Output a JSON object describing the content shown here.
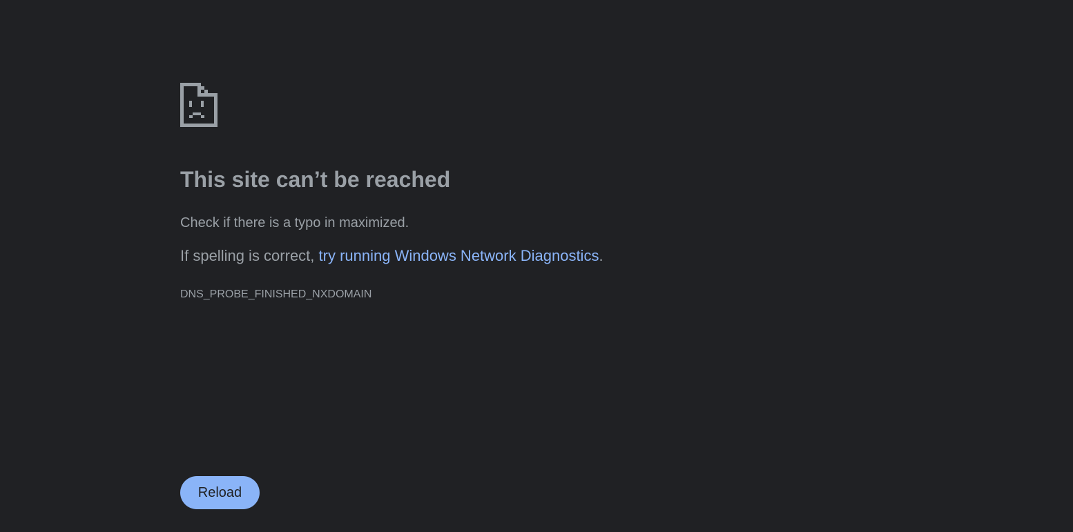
{
  "error_page": {
    "icon": "sad-document-icon",
    "title": "This site can’t be reached",
    "check_text": "Check if there is a typo in maximized.",
    "spelling_prefix": "If spelling is correct, ",
    "diagnostics_link": "try running Windows Network Diagnostics",
    "spelling_suffix": ".",
    "error_code": "DNS_PROBE_FINISHED_NXDOMAIN",
    "reload_label": "Reload"
  },
  "colors": {
    "background": "#202124",
    "text": "#9aa0a6",
    "accent": "#8ab4f8"
  }
}
